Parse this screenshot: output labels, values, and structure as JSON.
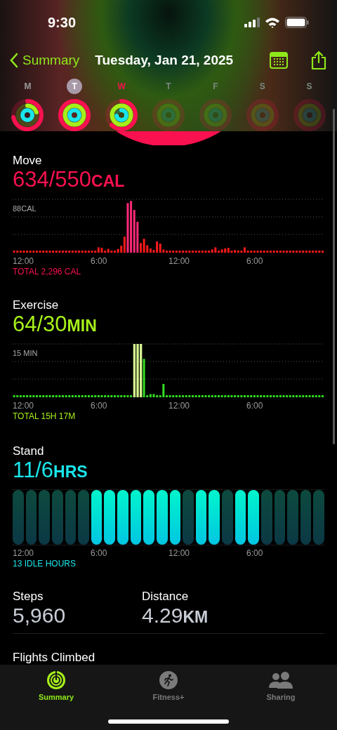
{
  "status_bar": {
    "time": "9:30"
  },
  "nav": {
    "back_label": "Summary",
    "title": "Tuesday, Jan 21, 2025"
  },
  "week": [
    {
      "letter": "M",
      "selected": false,
      "today": false,
      "dimmed": false
    },
    {
      "letter": "T",
      "selected": true,
      "today": false,
      "dimmed": false
    },
    {
      "letter": "W",
      "selected": false,
      "today": true,
      "dimmed": false
    },
    {
      "letter": "T",
      "selected": false,
      "today": false,
      "dimmed": true
    },
    {
      "letter": "F",
      "selected": false,
      "today": false,
      "dimmed": true
    },
    {
      "letter": "S",
      "selected": false,
      "today": false,
      "dimmed": true
    },
    {
      "letter": "S",
      "selected": false,
      "today": false,
      "dimmed": true
    }
  ],
  "move": {
    "title": "Move",
    "value": "634/550",
    "unit": "CAL",
    "scale_label": "88CAL",
    "times": [
      "12:00",
      "6:00",
      "12:00",
      "6:00"
    ],
    "total": "TOTAL 2,296 CAL"
  },
  "exercise": {
    "title": "Exercise",
    "value": "64/30",
    "unit": "MIN",
    "scale_label": "15 MIN",
    "times": [
      "12:00",
      "6:00",
      "12:00",
      "6:00"
    ],
    "total": "TOTAL 15H 17M"
  },
  "stand": {
    "title": "Stand",
    "value": "11/6",
    "unit": "HRS",
    "hours": [
      {
        "stood": false
      },
      {
        "stood": false
      },
      {
        "stood": false
      },
      {
        "stood": false
      },
      {
        "stood": false
      },
      {
        "stood": false
      },
      {
        "stood": true
      },
      {
        "stood": true
      },
      {
        "stood": true
      },
      {
        "stood": true
      },
      {
        "stood": true
      },
      {
        "stood": true
      },
      {
        "stood": true
      },
      {
        "stood": false
      },
      {
        "stood": true
      },
      {
        "stood": true
      },
      {
        "stood": false
      },
      {
        "stood": true
      },
      {
        "stood": true
      },
      {
        "stood": false
      },
      {
        "stood": false
      },
      {
        "stood": false
      },
      {
        "stood": false
      },
      {
        "stood": false
      }
    ],
    "times": [
      "12:00",
      "6:00",
      "12:00",
      "6:00"
    ],
    "idle": "13 IDLE HOURS"
  },
  "stats": [
    {
      "label": "Steps",
      "value": "5,960"
    },
    {
      "label": "Distance",
      "value": "4.29",
      "unit": "KM"
    }
  ],
  "flights": {
    "label": "Flights Climbed"
  },
  "tab_bar": [
    {
      "label": "Summary",
      "selected": true
    },
    {
      "label": "Fitness+",
      "selected": false
    },
    {
      "label": "Sharing",
      "selected": false
    }
  ]
}
